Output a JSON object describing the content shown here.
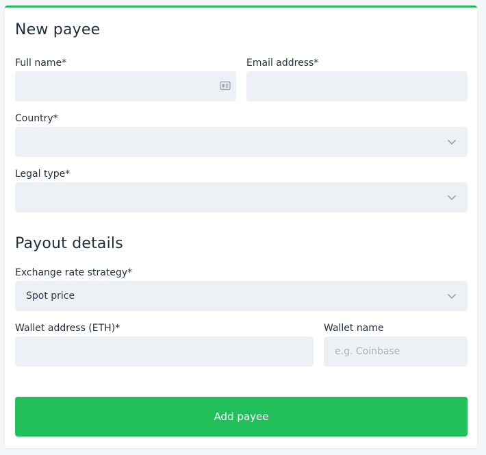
{
  "new_payee": {
    "title": "New payee",
    "full_name": {
      "label": "Full name*",
      "value": "",
      "icon": "contact-card-icon"
    },
    "email": {
      "label": "Email address*",
      "value": ""
    },
    "country": {
      "label": "Country*",
      "value": ""
    },
    "legal_type": {
      "label": "Legal type*",
      "value": ""
    }
  },
  "payout_details": {
    "title": "Payout details",
    "exchange_rate_strategy": {
      "label": "Exchange rate strategy*",
      "value": "Spot price"
    },
    "wallet_address": {
      "label": "Wallet address (ETH)*",
      "value": ""
    },
    "wallet_name": {
      "label": "Wallet name",
      "value": "",
      "placeholder": "e.g. Coinbase"
    }
  },
  "submit": {
    "label": "Add payee"
  },
  "colors": {
    "accent": "#22c05a",
    "field_bg": "#edf1f5",
    "placeholder": "#a6b1bd",
    "icon": "#9aa6b3"
  }
}
